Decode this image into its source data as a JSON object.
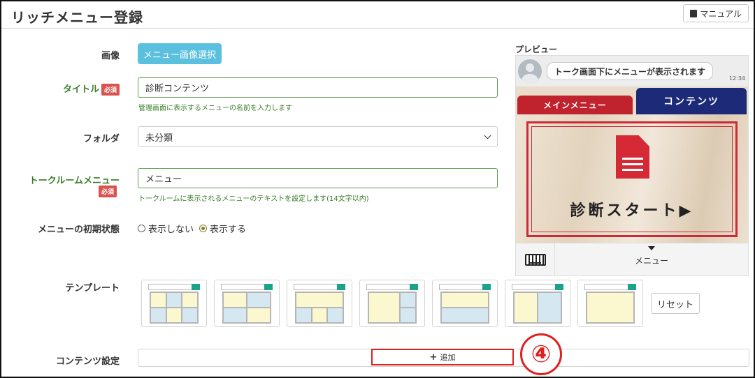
{
  "header": {
    "title": "リッチメニュー登録",
    "manual_label": "マニュアル"
  },
  "form": {
    "image": {
      "label": "画像",
      "button_label": "メニュー画像選択"
    },
    "title_field": {
      "label": "タイトル",
      "required_badge": "必須",
      "value": "診断コンテンツ",
      "help": "管理画面に表示するメニューの名前を入力します"
    },
    "folder": {
      "label": "フォルダ",
      "selected": "未分類"
    },
    "talk_menu": {
      "label": "トークルームメニュー",
      "required_badge": "必須",
      "value": "メニュー",
      "help": "トークルームに表示されるメニューのテキストを設定します(14文字以内)"
    },
    "initial_state": {
      "label": "メニューの初期状態",
      "option_hide": "表示しない",
      "option_show": "表示する",
      "selected": "表示する"
    },
    "template": {
      "label": "テンプレート",
      "reset_label": "リセット"
    },
    "contents": {
      "label": "コンテンツ設定",
      "add_label": "追加"
    }
  },
  "annotation": {
    "step_number": "④",
    "color": "#e02020"
  },
  "preview": {
    "label": "プレビュー",
    "chat_bubble": "トーク画面下にメニューが表示されます",
    "chat_time": "12:34",
    "tab_main": "メインメニュー",
    "tab_contents": "コンテンツ",
    "cta": "診断スタート▶",
    "menu_toggle": "メニュー"
  },
  "colors": {
    "accent_green": "#3a7d2a",
    "required_red": "#d9534f",
    "button_cyan": "#5bc0de",
    "tab_red": "#c0232e",
    "tab_navy": "#1d2a78"
  }
}
